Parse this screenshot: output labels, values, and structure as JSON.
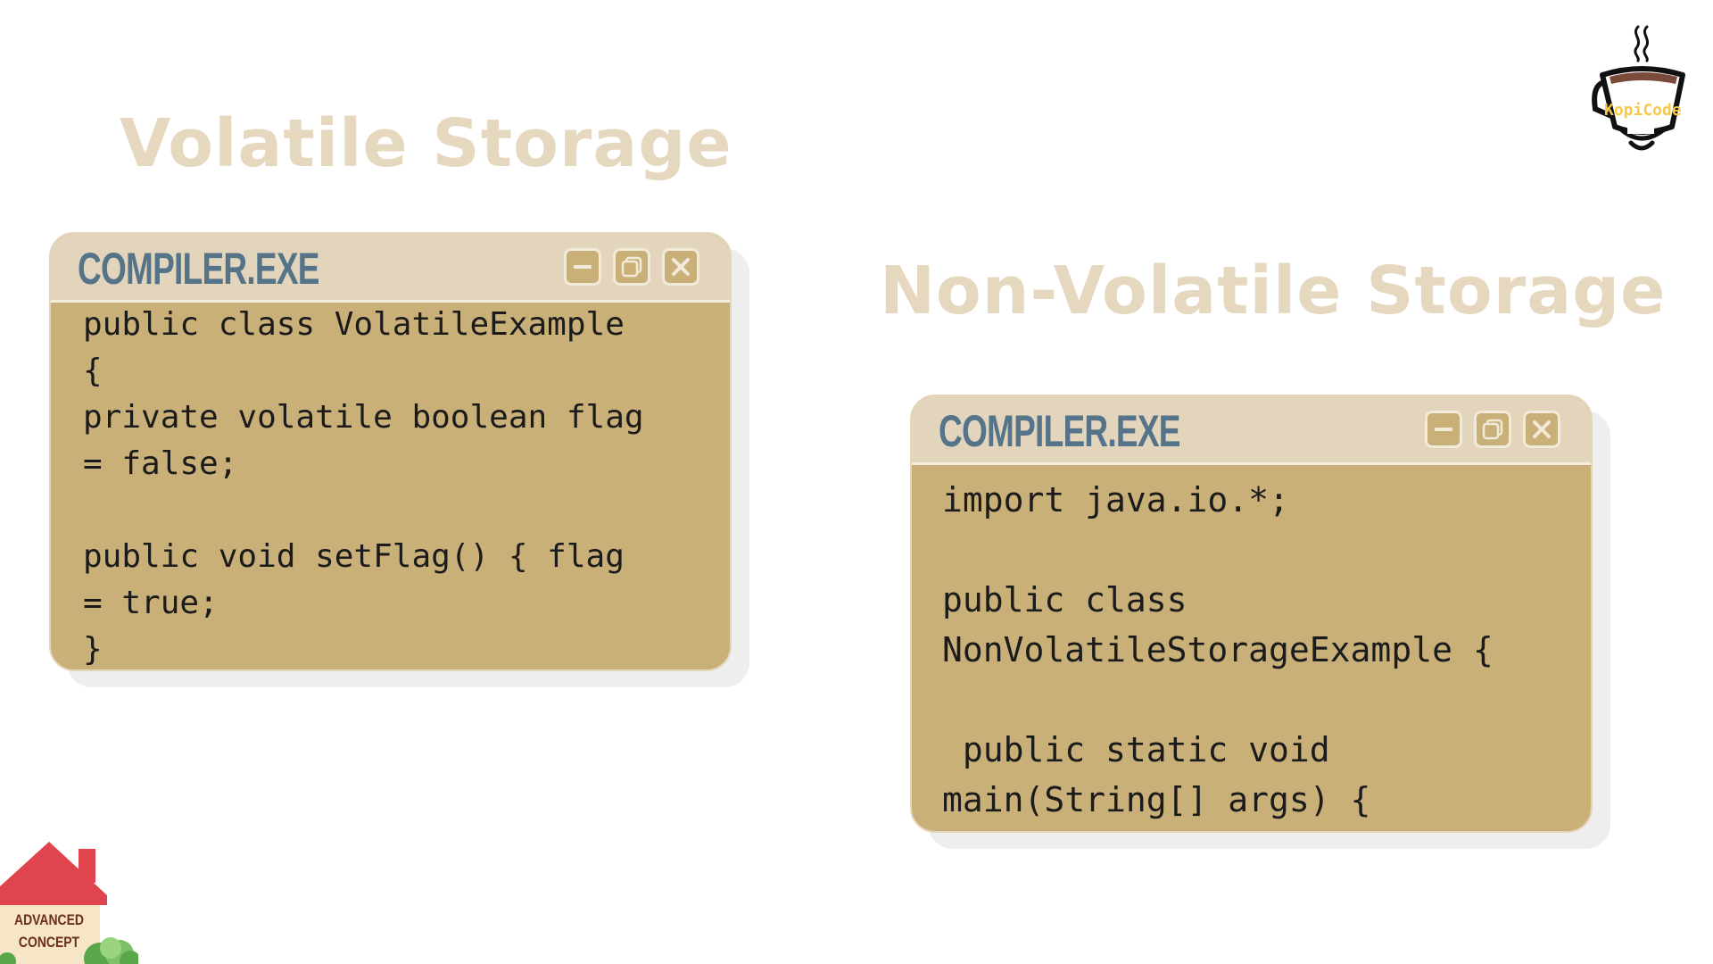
{
  "headings": {
    "left": "Volatile Storage",
    "right": "Non-Volatile Storage"
  },
  "windows": [
    {
      "title": "COMPILER.EXE",
      "controls": [
        "minimize-icon",
        "restore-icon",
        "close-icon"
      ],
      "code": "public class VolatileExample\n{\nprivate volatile boolean flag\n= false;\n\npublic void setFlag() { flag\n= true;\n}"
    },
    {
      "title": "COMPILER.EXE",
      "controls": [
        "minimize-icon",
        "restore-icon",
        "close-icon"
      ],
      "code": "import java.io.*;\n\npublic class\nNonVolatileStorageExample {\n\n public static void\nmain(String[] args) {"
    }
  ],
  "logo": {
    "text": "KopiCode",
    "icon": "coffee-cup-icon"
  },
  "badge": {
    "line1": "ADVANCED",
    "line2": "CONCEPT",
    "icon": "house-icon"
  },
  "colors": {
    "heading": "#e6d7bf",
    "window_body": "#c9b078",
    "titlebar": "#e3d5bb",
    "window_title": "#557389",
    "badge_roof": "#e0454f",
    "logo_text": "#f7c948"
  }
}
